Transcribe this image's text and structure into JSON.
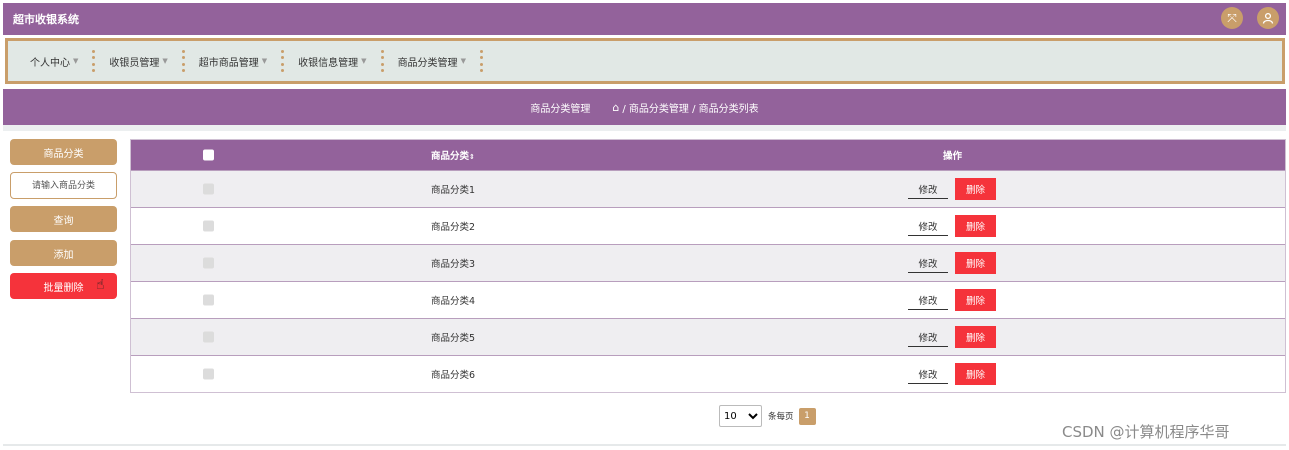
{
  "app": {
    "title": "超市收银系统"
  },
  "header": {
    "expand_icon": "expand-arrows-icon",
    "user_icon": "user-avatar-icon"
  },
  "nav": {
    "items": [
      {
        "label": "个人中心"
      },
      {
        "label": "收银员管理"
      },
      {
        "label": "超市商品管理"
      },
      {
        "label": "收银信息管理"
      },
      {
        "label": "商品分类管理"
      }
    ]
  },
  "breadcrumb": {
    "title": "商品分类管理",
    "path": "/ 商品分类管理 / 商品分类列表"
  },
  "sidebar": {
    "label": "商品分类",
    "search_placeholder": "请输入商品分类",
    "query_label": "查询",
    "add_label": "添加",
    "batch_delete_label": "批量删除"
  },
  "table": {
    "headers": {
      "name": "商品分类",
      "sort_icon": "sort-arrows-icon",
      "ops": "操作"
    },
    "rows": [
      {
        "name": "商品分类1",
        "edit": "修改",
        "delete": "删除"
      },
      {
        "name": "商品分类2",
        "edit": "修改",
        "delete": "删除"
      },
      {
        "name": "商品分类3",
        "edit": "修改",
        "delete": "删除"
      },
      {
        "name": "商品分类4",
        "edit": "修改",
        "delete": "删除"
      },
      {
        "name": "商品分类5",
        "edit": "修改",
        "delete": "删除"
      },
      {
        "name": "商品分类6",
        "edit": "修改",
        "delete": "删除"
      }
    ]
  },
  "pagination": {
    "page_size": "10",
    "per_page_label": "条每页",
    "current_page": "1"
  },
  "watermark": "CSDN @计算机程序华哥",
  "colors": {
    "primary": "#93629b",
    "accent": "#c99e6a",
    "danger": "#f5333b",
    "nav_bg": "#e1e8e5"
  }
}
